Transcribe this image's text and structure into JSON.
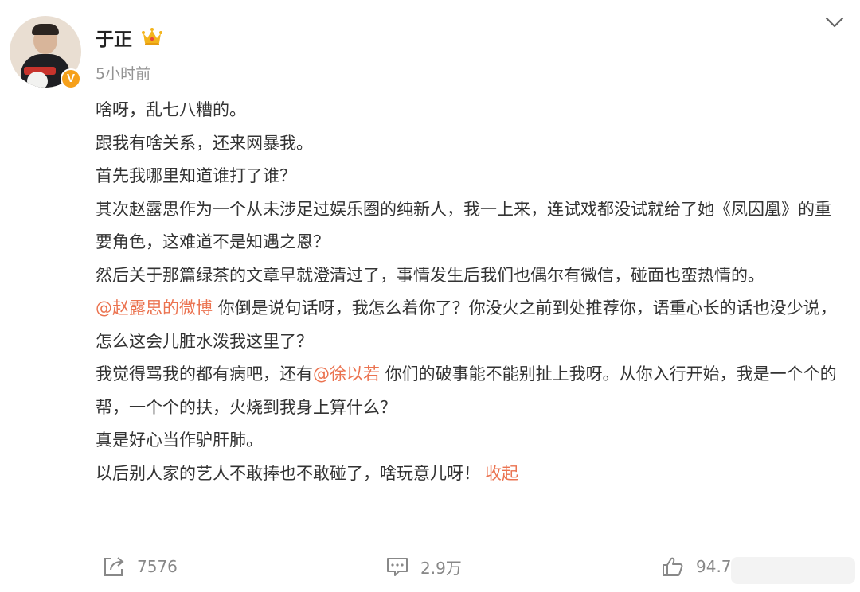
{
  "author": {
    "name": "于正",
    "time": "5小时前",
    "verified_badge": "V",
    "avatar_icon": "avatar",
    "crown_icon": "crown-icon",
    "colors": {
      "badge": "#f6a01a",
      "crown": "#f3b41c"
    }
  },
  "post": {
    "lines": {
      "l1": "啥呀，乱七八糟的。",
      "l2": "跟我有啥关系，还来网暴我。",
      "l3": "首先我哪里知道谁打了谁？",
      "l4": "其次赵露思作为一个从未涉足过娱乐圈的纯新人，我一上来，连试戏都没试就给了她《凤囚凰》的重要角色，这难道不是知遇之恩？",
      "l5": "然后关于那篇绿茶的文章早就澄清过了，事情发生后我们也偶尔有微信，碰面也蛮热情的。",
      "l6_mention": "@赵露思的微博",
      "l6_text": " 你倒是说句话呀，我怎么着你了？你没火之前到处推荐你，语重心长的话也没少说，怎么这会儿脏水泼我这里了？",
      "l7_pre": "我觉得骂我的都有病吧，还有",
      "l7_mention": "@徐以若",
      "l7_post": " 你们的破事能不能别扯上我呀。从你入行开始，我是一个个的帮，一个个的扶，火烧到我身上算什么？",
      "l8": "真是好心当作驴肝肺。",
      "l9": "以后别人家的艺人不敢捧也不敢碰了，啥玩意儿呀！"
    },
    "collapse_label": "收起",
    "link_color": "#eb7350"
  },
  "actions": {
    "repost": {
      "icon": "repost-icon",
      "count": "7576"
    },
    "comment": {
      "icon": "comment-icon",
      "count": "2.9万"
    },
    "like": {
      "icon": "like-icon",
      "count": "94.7"
    }
  }
}
